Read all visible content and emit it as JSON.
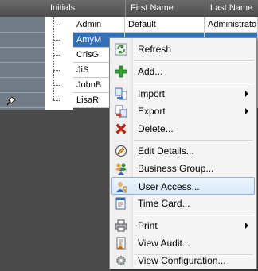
{
  "grid": {
    "columns": [
      {
        "id": "initials",
        "label": "Initials"
      },
      {
        "id": "first_name",
        "label": "First Name"
      },
      {
        "id": "last_name",
        "label": "Last Name"
      }
    ],
    "rows": [
      {
        "initials": "Admin",
        "first_name": "Default",
        "last_name": "Administrator",
        "selected": false
      },
      {
        "initials": "AmyM",
        "first_name": "",
        "last_name": "",
        "selected": true
      },
      {
        "initials": "CrisG",
        "first_name": "",
        "last_name": "",
        "selected": false
      },
      {
        "initials": "JiS",
        "first_name": "",
        "last_name": "",
        "selected": false
      },
      {
        "initials": "JohnB",
        "first_name": "",
        "last_name": "",
        "selected": false
      },
      {
        "initials": "LisaR",
        "first_name": "",
        "last_name": "",
        "selected": false
      }
    ]
  },
  "context_menu": {
    "items": [
      {
        "label": "Refresh",
        "icon": "refresh-icon",
        "submenu": false,
        "highlighted": false
      },
      {
        "label": "Add...",
        "icon": "add-icon",
        "submenu": false,
        "highlighted": false
      },
      {
        "label": "Import",
        "icon": "import-icon",
        "submenu": true,
        "highlighted": false
      },
      {
        "label": "Export",
        "icon": "export-icon",
        "submenu": true,
        "highlighted": false
      },
      {
        "label": "Delete...",
        "icon": "delete-icon",
        "submenu": false,
        "highlighted": false
      },
      {
        "label": "Edit Details...",
        "icon": "edit-icon",
        "submenu": false,
        "highlighted": false
      },
      {
        "label": "Business Group...",
        "icon": "business-group-icon",
        "submenu": false,
        "highlighted": false
      },
      {
        "label": "User Access...",
        "icon": "user-access-icon",
        "submenu": false,
        "highlighted": true
      },
      {
        "label": "Time Card...",
        "icon": "time-card-icon",
        "submenu": false,
        "highlighted": false
      },
      {
        "label": "Print",
        "icon": "print-icon",
        "submenu": true,
        "highlighted": false
      },
      {
        "label": "View Audit...",
        "icon": "audit-icon",
        "submenu": false,
        "highlighted": false
      },
      {
        "label": "View Configuration...",
        "icon": "configuration-icon",
        "submenu": false,
        "highlighted": false
      }
    ]
  },
  "colors": {
    "selection": "#3470b8",
    "menu_highlight_border": "#8db2e3"
  }
}
